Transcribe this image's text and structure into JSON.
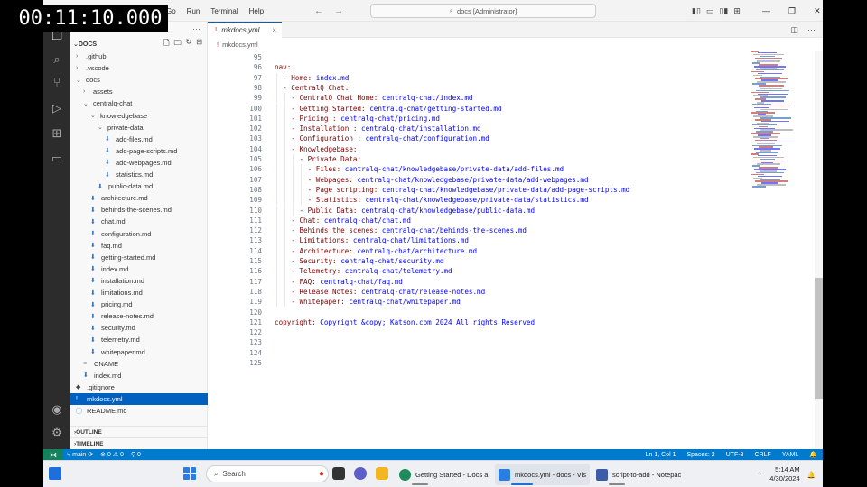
{
  "timer": "00:11:10.000",
  "titlebar": {
    "menus": [
      "Go",
      "Run",
      "Terminal",
      "Help"
    ],
    "search_text": "docs [Administrator]"
  },
  "explorer": {
    "root_label": "DOCS",
    "tree": [
      {
        "label": ".github",
        "kind": "folder",
        "depth": 1,
        "open": false
      },
      {
        "label": ".vscode",
        "kind": "folder",
        "depth": 1,
        "open": false
      },
      {
        "label": "docs",
        "kind": "folder",
        "depth": 1,
        "open": true
      },
      {
        "label": "assets",
        "kind": "folder",
        "depth": 2,
        "open": false
      },
      {
        "label": "centralq-chat",
        "kind": "folder",
        "depth": 2,
        "open": true
      },
      {
        "label": "knowledgebase",
        "kind": "folder",
        "depth": 3,
        "open": true
      },
      {
        "label": "private-data",
        "kind": "folder",
        "depth": 4,
        "open": true
      },
      {
        "label": "add-files.md",
        "kind": "md",
        "depth": 5
      },
      {
        "label": "add-page-scripts.md",
        "kind": "md",
        "depth": 5
      },
      {
        "label": "add-webpages.md",
        "kind": "md",
        "depth": 5
      },
      {
        "label": "statistics.md",
        "kind": "md",
        "depth": 5
      },
      {
        "label": "public-data.md",
        "kind": "md",
        "depth": 4
      },
      {
        "label": "architecture.md",
        "kind": "md",
        "depth": 3
      },
      {
        "label": "behinds-the-scenes.md",
        "kind": "md",
        "depth": 3
      },
      {
        "label": "chat.md",
        "kind": "md",
        "depth": 3
      },
      {
        "label": "configuration.md",
        "kind": "md",
        "depth": 3
      },
      {
        "label": "faq.md",
        "kind": "md",
        "depth": 3
      },
      {
        "label": "getting-started.md",
        "kind": "md",
        "depth": 3
      },
      {
        "label": "index.md",
        "kind": "md",
        "depth": 3
      },
      {
        "label": "installation.md",
        "kind": "md",
        "depth": 3
      },
      {
        "label": "limitations.md",
        "kind": "md",
        "depth": 3
      },
      {
        "label": "pricing.md",
        "kind": "md",
        "depth": 3
      },
      {
        "label": "release-notes.md",
        "kind": "md",
        "depth": 3
      },
      {
        "label": "security.md",
        "kind": "md",
        "depth": 3
      },
      {
        "label": "telemetry.md",
        "kind": "md",
        "depth": 3
      },
      {
        "label": "whitepaper.md",
        "kind": "md",
        "depth": 3
      },
      {
        "label": "CNAME",
        "kind": "plain",
        "depth": 2
      },
      {
        "label": "index.md",
        "kind": "md",
        "depth": 2
      },
      {
        "label": ".gitignore",
        "kind": "git",
        "depth": 1
      },
      {
        "label": "mkdocs.yml",
        "kind": "yml",
        "depth": 1,
        "selected": true
      },
      {
        "label": "README.md",
        "kind": "info",
        "depth": 1
      }
    ],
    "outline_label": "OUTLINE",
    "timeline_label": "TIMELINE"
  },
  "editor": {
    "tab_label": "mkdocs.yml",
    "breadcrumb": "mkdocs.yml",
    "lines": [
      {
        "n": "95",
        "indent": 0,
        "key": "",
        "value": ""
      },
      {
        "n": "96",
        "indent": 0,
        "key": "nav:",
        "value": ""
      },
      {
        "n": "97",
        "indent": 1,
        "key": "- Home:",
        "value": "index.md"
      },
      {
        "n": "98",
        "indent": 1,
        "key": "- CentralQ Chat:",
        "value": ""
      },
      {
        "n": "99",
        "indent": 2,
        "key": "- CentralQ Chat Home:",
        "value": "centralq-chat/index.md"
      },
      {
        "n": "100",
        "indent": 2,
        "key": "- Getting Started:",
        "value": "centralq-chat/getting-started.md"
      },
      {
        "n": "101",
        "indent": 2,
        "key": "- Pricing :",
        "value": "centralq-chat/pricing.md"
      },
      {
        "n": "102",
        "indent": 2,
        "key": "- Installation :",
        "value": "centralq-chat/installation.md"
      },
      {
        "n": "103",
        "indent": 2,
        "key": "- Configuration :",
        "value": "centralq-chat/configuration.md"
      },
      {
        "n": "104",
        "indent": 2,
        "key": "- Knowledgebase:",
        "value": ""
      },
      {
        "n": "105",
        "indent": 3,
        "key": "- Private Data:",
        "value": ""
      },
      {
        "n": "106",
        "indent": 4,
        "key": "- Files:",
        "value": "centralq-chat/knowledgebase/private-data/add-files.md"
      },
      {
        "n": "107",
        "indent": 4,
        "key": "- Webpages:",
        "value": "centralq-chat/knowledgebase/private-data/add-webpages.md"
      },
      {
        "n": "108",
        "indent": 4,
        "key": "- Page scripting:",
        "value": "centralq-chat/knowledgebase/private-data/add-page-scripts.md"
      },
      {
        "n": "109",
        "indent": 4,
        "key": "- Statistics:",
        "value": "centralq-chat/knowledgebase/private-data/statistics.md"
      },
      {
        "n": "110",
        "indent": 3,
        "key": "- Public Data:",
        "value": "centralq-chat/knowledgebase/public-data.md"
      },
      {
        "n": "111",
        "indent": 2,
        "key": "- Chat:",
        "value": "centralq-chat/chat.md"
      },
      {
        "n": "112",
        "indent": 2,
        "key": "- Behinds the scenes:",
        "value": "centralq-chat/behinds-the-scenes.md"
      },
      {
        "n": "113",
        "indent": 2,
        "key": "- Limitations:",
        "value": "centralq-chat/limitations.md"
      },
      {
        "n": "114",
        "indent": 2,
        "key": "- Architecture:",
        "value": "centralq-chat/architecture.md"
      },
      {
        "n": "115",
        "indent": 2,
        "key": "- Security:",
        "value": "centralq-chat/security.md"
      },
      {
        "n": "116",
        "indent": 2,
        "key": "- Telemetry:",
        "value": "centralq-chat/telemetry.md"
      },
      {
        "n": "117",
        "indent": 2,
        "key": "- FAQ:",
        "value": "centralq-chat/faq.md"
      },
      {
        "n": "118",
        "indent": 2,
        "key": "- Release Notes:",
        "value": "centralq-chat/release-notes.md"
      },
      {
        "n": "119",
        "indent": 2,
        "key": "- Whitepaper:",
        "value": "centralq-chat/whitepaper.md"
      },
      {
        "n": "120",
        "indent": 0,
        "key": "",
        "value": ""
      },
      {
        "n": "121",
        "indent": 0,
        "key": "copyright:",
        "value": "Copyright &copy; Katson.com 2024 All rights Reserved"
      },
      {
        "n": "122",
        "indent": 0,
        "key": "",
        "value": ""
      },
      {
        "n": "123",
        "indent": 0,
        "key": "",
        "value": ""
      },
      {
        "n": "124",
        "indent": 0,
        "key": "",
        "value": ""
      },
      {
        "n": "125",
        "indent": 0,
        "key": "",
        "value": ""
      }
    ]
  },
  "statusbar": {
    "branch": "main",
    "errors": "0",
    "warnings": "0",
    "ports": "0",
    "position": "Ln 1, Col 1",
    "spaces": "Spaces: 2",
    "encoding": "UTF-8",
    "eol": "CRLF",
    "language": "YAML"
  },
  "taskbar": {
    "search_placeholder": "Search",
    "apps": [
      {
        "label": "Getting Started - Docs a",
        "color": "#1f8a5a",
        "active": false
      },
      {
        "label": "mkdocs.yml - docs - Vis",
        "color": "#2a7de1",
        "active": true
      },
      {
        "label": "script-to-add - Notepac",
        "color": "#3b5da8",
        "active": false
      }
    ],
    "time": "5:14 AM",
    "date": "4/30/2024"
  },
  "colors": {
    "accent": "#007acc",
    "selection": "#0060c0",
    "yaml_key": "#800000",
    "yaml_value": "#0000ff"
  }
}
